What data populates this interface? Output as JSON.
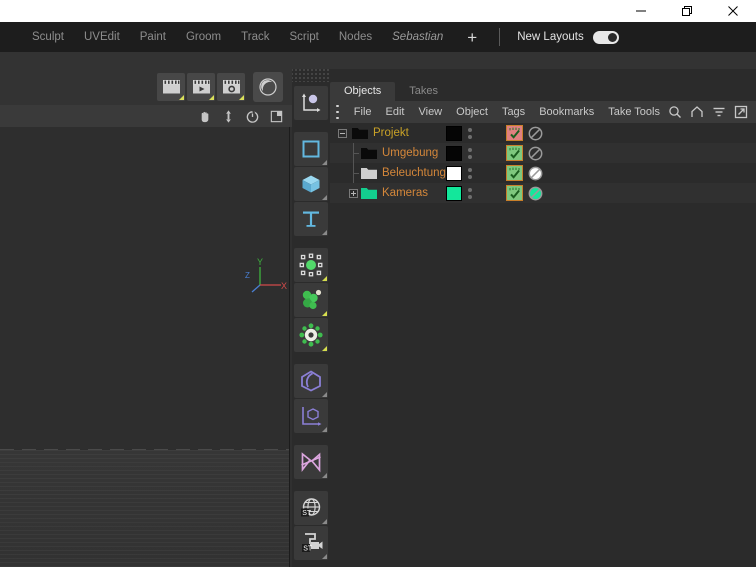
{
  "window": {
    "buttons": [
      {
        "name": "minimize-button",
        "glyph": "minimize"
      },
      {
        "name": "restore-button",
        "glyph": "restore"
      },
      {
        "name": "close-button",
        "glyph": "close"
      }
    ]
  },
  "layout_bar": {
    "tabs": [
      {
        "label": "Sculpt",
        "italic": false
      },
      {
        "label": "UVEdit",
        "italic": false
      },
      {
        "label": "Paint",
        "italic": false
      },
      {
        "label": "Groom",
        "italic": false
      },
      {
        "label": "Track",
        "italic": false
      },
      {
        "label": "Script",
        "italic": false
      },
      {
        "label": "Nodes",
        "italic": false
      },
      {
        "label": "Sebastian",
        "italic": true
      }
    ],
    "add_label": "+",
    "new_layouts_label": "New Layouts",
    "toggle_on": true
  },
  "viewport": {
    "top_tools": [
      {
        "name": "clapper-record-icon"
      },
      {
        "name": "clapper-play-icon"
      },
      {
        "name": "clapper-settings-icon"
      },
      {
        "name": "moon-shading-icon"
      }
    ],
    "nav_tools": [
      {
        "name": "pan-hand-icon"
      },
      {
        "name": "move-camera-icon"
      },
      {
        "name": "rotate-camera-icon"
      },
      {
        "name": "viewport-layout-icon"
      }
    ],
    "axis": {
      "x": "X",
      "y": "Y",
      "z": "Z",
      "x_color": "#d24a4a",
      "y_color": "#3fb23f",
      "z_color": "#4a7fd2"
    }
  },
  "tool_palette": {
    "groups": [
      {
        "tools": [
          {
            "name": "axis-move-tool-icon",
            "corner": "none"
          }
        ]
      },
      {
        "tools": [
          {
            "name": "rectangle-selection-tool-icon",
            "corner": "gray"
          },
          {
            "name": "cube-primitive-tool-icon",
            "corner": "gray"
          },
          {
            "name": "text-tool-icon",
            "corner": "gray"
          }
        ]
      },
      {
        "tools": [
          {
            "name": "null-object-tool-icon",
            "corner": "yellow"
          },
          {
            "name": "array-object-tool-icon",
            "corner": "yellow"
          },
          {
            "name": "deformer-tool-icon",
            "corner": "yellow"
          }
        ]
      },
      {
        "tools": [
          {
            "name": "spline-tool-icon",
            "corner": "gray"
          },
          {
            "name": "coordinate-object-tool-icon",
            "corner": "gray"
          }
        ]
      },
      {
        "tools": [
          {
            "name": "cloner-tool-icon",
            "corner": "gray"
          }
        ]
      },
      {
        "tools": [
          {
            "name": "environment-globe-tool-icon",
            "corner": "gray"
          },
          {
            "name": "camera-tool-icon",
            "corner": "gray"
          }
        ]
      }
    ]
  },
  "object_manager": {
    "tabs": [
      {
        "label": "Objects",
        "active": true
      },
      {
        "label": "Takes",
        "active": false
      }
    ],
    "menu_items": [
      "File",
      "Edit",
      "View",
      "Object",
      "Tags",
      "Bookmarks",
      "Take Tools"
    ],
    "right_icons": [
      {
        "name": "search-icon"
      },
      {
        "name": "home-icon"
      },
      {
        "name": "filter-icon"
      },
      {
        "name": "open-external-icon"
      }
    ],
    "rows": [
      {
        "label": "Projekt",
        "depth": 0,
        "expander": "minus",
        "folder_color": "#0a0a0a",
        "swatch_color": "#050505",
        "tag": "red",
        "tag_mark": "✔",
        "has_noentry": true,
        "alt": false
      },
      {
        "label": "Umgebung",
        "depth": 1,
        "expander": "none",
        "folder_color": "#0a0a0a",
        "swatch_color": "#050505",
        "tag": "green",
        "tag_mark": "✔",
        "has_noentry": true,
        "alt": true
      },
      {
        "label": "Beleuchtung",
        "depth": 1,
        "expander": "none",
        "folder_color": "#cfcfcf",
        "swatch_color": "#ffffff",
        "tag": "green",
        "tag_mark": "✔",
        "has_noentry": true,
        "alt": false
      },
      {
        "label": "Kameras",
        "depth": 1,
        "expander": "plus",
        "folder_color": "#13cf8e",
        "swatch_color": "#13e79b",
        "tag": "green",
        "tag_mark": "✔",
        "has_noentry": true,
        "alt": true
      }
    ]
  },
  "colors": {
    "accent_orange": "#d4873a",
    "root_label": "#c9a227",
    "panel_bg": "#2b2b2b",
    "bar_bg": "#3a3a3a",
    "tag_border": "#c87f2a"
  }
}
